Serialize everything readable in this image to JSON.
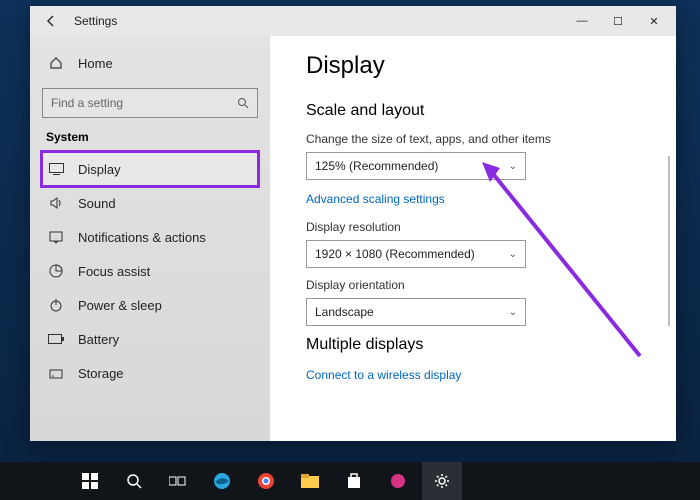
{
  "window": {
    "title": "Settings",
    "controls": {
      "min": "—",
      "max": "☐",
      "close": "✕"
    }
  },
  "sidebar": {
    "home": "Home",
    "search_placeholder": "Find a setting",
    "section": "System",
    "items": [
      {
        "label": "Display",
        "icon": "display"
      },
      {
        "label": "Sound",
        "icon": "sound"
      },
      {
        "label": "Notifications & actions",
        "icon": "notifications"
      },
      {
        "label": "Focus assist",
        "icon": "focus"
      },
      {
        "label": "Power & sleep",
        "icon": "power"
      },
      {
        "label": "Battery",
        "icon": "battery"
      },
      {
        "label": "Storage",
        "icon": "storage"
      }
    ]
  },
  "content": {
    "heading": "Display",
    "scale_heading": "Scale and layout",
    "scale_label": "Change the size of text, apps, and other items",
    "scale_value": "125% (Recommended)",
    "advanced_link": "Advanced scaling settings",
    "resolution_label": "Display resolution",
    "resolution_value": "1920 × 1080 (Recommended)",
    "orientation_label": "Display orientation",
    "orientation_value": "Landscape",
    "multiple_heading": "Multiple displays",
    "wireless_link": "Connect to a wireless display"
  },
  "annotation": {
    "color": "#8a2be2"
  },
  "taskbar": {
    "items": [
      "start",
      "search",
      "taskview",
      "edge",
      "chrome",
      "explorer",
      "store",
      "app1",
      "settings"
    ]
  }
}
